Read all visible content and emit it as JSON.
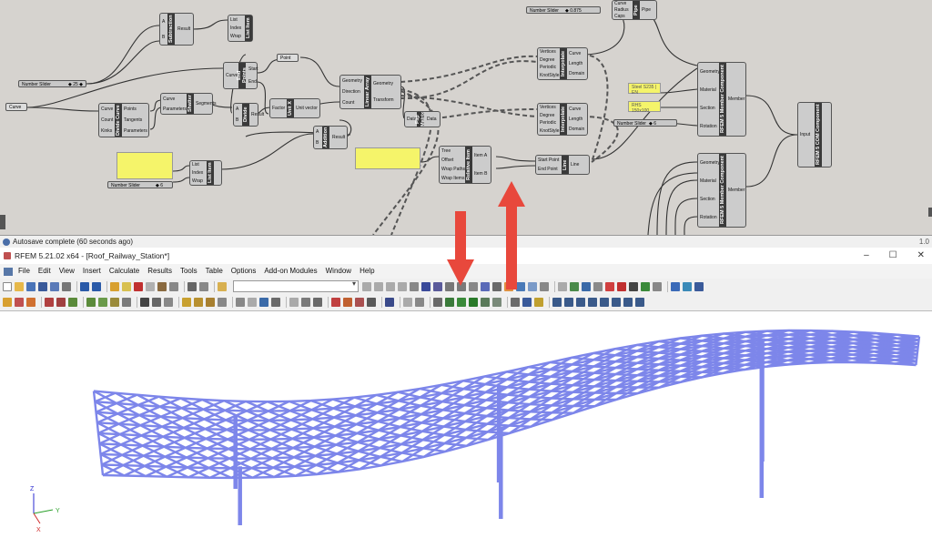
{
  "grasshopper": {
    "status": "Autosave complete (60 seconds ago)",
    "version_label": "1.0",
    "sliders": [
      {
        "label": "Number Slider",
        "value": "◆ 25 ◆"
      },
      {
        "label": "Number Slider",
        "value": "◆ 0.875"
      },
      {
        "label": "Number Slider",
        "value": "◆ 6"
      },
      {
        "label": "Number Slider",
        "value": "◆ 6"
      }
    ],
    "params": {
      "curve": "Curve",
      "point": "Point",
      "data": "Data"
    },
    "components": [
      {
        "id": "subtraction",
        "name": "Subtraction",
        "inputs": [
          "A",
          "B"
        ],
        "outputs": [
          "Result"
        ]
      },
      {
        "id": "list-item-1",
        "name": "List Item",
        "inputs": [
          "List",
          "Index",
          "Wrap"
        ],
        "outputs": [
          "i"
        ]
      },
      {
        "id": "end-points",
        "name": "End Points",
        "inputs": [
          "Curve"
        ],
        "outputs": [
          "Start",
          "End"
        ]
      },
      {
        "id": "divide-curve",
        "name": "Divide Curve",
        "inputs": [
          "Curve",
          "Count",
          "Kinks"
        ],
        "outputs": [
          "Points",
          "Tangents",
          "Parameters"
        ]
      },
      {
        "id": "shatter",
        "name": "Shatter",
        "inputs": [
          "Curve",
          "Parameters"
        ],
        "outputs": [
          "Segments"
        ]
      },
      {
        "id": "divide",
        "name": "Divide",
        "inputs": [
          "A",
          "B"
        ],
        "outputs": [
          "Result"
        ]
      },
      {
        "id": "unit-x",
        "name": "Unit X",
        "inputs": [
          "Factor"
        ],
        "outputs": [
          "Unit vector"
        ]
      },
      {
        "id": "linear-array",
        "name": "Linear Array",
        "inputs": [
          "Geometry",
          "Direction",
          "Count"
        ],
        "outputs": [
          "Geometry",
          "Transform"
        ]
      },
      {
        "id": "addition",
        "name": "Addition",
        "inputs": [
          "A",
          "B"
        ],
        "outputs": [
          "Result"
        ]
      },
      {
        "id": "list-item-2",
        "name": "List Item",
        "inputs": [
          "List",
          "Index",
          "Wrap"
        ],
        "outputs": [
          "i"
        ]
      },
      {
        "id": "flip-matrix",
        "name": "Flip Matrix",
        "inputs": [
          "Data"
        ],
        "outputs": [
          "Data"
        ]
      },
      {
        "id": "relative-item",
        "name": "Relative Item",
        "inputs": [
          "Tree",
          "Offset",
          "Wrap Paths",
          "Wrap Items"
        ],
        "outputs": [
          "Item A",
          "Item B"
        ]
      },
      {
        "id": "interpolate-1",
        "name": "Interpolate",
        "inputs": [
          "Vertices",
          "Degree",
          "Periodic",
          "KnotStyle"
        ],
        "outputs": [
          "Curve",
          "Length",
          "Domain"
        ]
      },
      {
        "id": "interpolate-2",
        "name": "Interpolate",
        "inputs": [
          "Vertices",
          "Degree",
          "Periodic",
          "KnotStyle"
        ],
        "outputs": [
          "Curve",
          "Length",
          "Domain"
        ]
      },
      {
        "id": "line",
        "name": "Line",
        "inputs": [
          "Start Point",
          "End Point"
        ],
        "outputs": [
          "Line"
        ]
      },
      {
        "id": "pipe",
        "name": "Pipe",
        "inputs": [
          "Curve",
          "Radius",
          "Caps"
        ],
        "outputs": [
          "Pipe"
        ]
      },
      {
        "id": "rfem-member-1",
        "name": "RFEM 5 Member Component",
        "inputs": [
          "Geometry",
          "Material",
          "Section",
          "Rotation"
        ],
        "outputs": [
          "Member"
        ]
      },
      {
        "id": "rfem-member-2",
        "name": "RFEM 5 Member Component",
        "inputs": [
          "Geometry",
          "Material",
          "Section",
          "Rotation"
        ],
        "outputs": [
          "Member"
        ]
      },
      {
        "id": "rfem-com",
        "name": "RFEM 5 COM Component",
        "inputs": [
          "Input"
        ],
        "outputs": []
      }
    ],
    "panels": [
      {
        "text": "Steel S235 | EN"
      },
      {
        "text": "RHS 150x100"
      }
    ]
  },
  "rfem": {
    "title": "RFEM 5.21.02 x64 - [Roof_Railway_Station*]",
    "window_controls": [
      "–",
      "☐",
      "✕"
    ],
    "menu": [
      "File",
      "Edit",
      "View",
      "Insert",
      "Calculate",
      "Results",
      "Tools",
      "Table",
      "Options",
      "Add-on Modules",
      "Window",
      "Help"
    ],
    "axes": {
      "x": "X",
      "y": "Y",
      "z": "Z"
    }
  },
  "colors": {
    "canvas": "#d6d3cf",
    "arrow": "#e8483c",
    "member": "#7d86ea",
    "panel": "#f5f46a",
    "component_label": "#3a3a3a"
  }
}
